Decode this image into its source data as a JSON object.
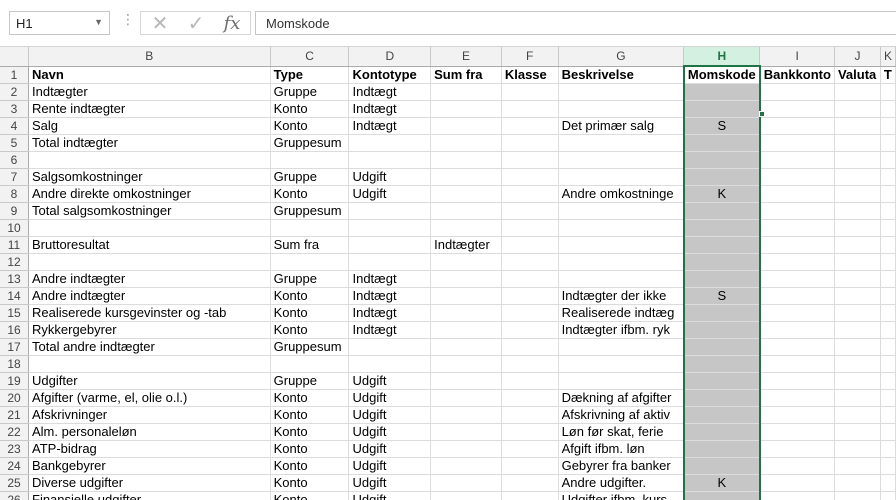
{
  "formula_bar": {
    "name_box": "H1",
    "cancel_icon": "✕",
    "enter_icon": "✓",
    "function_icon": "fx",
    "content": "Momskode"
  },
  "columns": [
    "B",
    "C",
    "D",
    "E",
    "F",
    "G",
    "H",
    "I",
    "J",
    "K"
  ],
  "rows": [
    {
      "n": "1",
      "c": [
        "Navn",
        "Type",
        "Kontotype",
        "Sum fra",
        "Klasse",
        "Beskrivelse",
        "Momskode",
        "Bankkonto",
        "Valuta",
        "T"
      ]
    },
    {
      "n": "2",
      "c": [
        "Indtægter",
        "Gruppe",
        "Indtægt",
        "",
        "",
        "",
        "",
        "",
        "",
        ""
      ]
    },
    {
      "n": "3",
      "c": [
        "Rente indtægter",
        "Konto",
        "Indtægt",
        "",
        "",
        "",
        "",
        "",
        "",
        ""
      ]
    },
    {
      "n": "4",
      "c": [
        "Salg",
        "Konto",
        "Indtægt",
        "",
        "",
        "Det primær salg",
        "S",
        "",
        "",
        ""
      ]
    },
    {
      "n": "5",
      "c": [
        "Total indtægter",
        "Gruppesum",
        "",
        "",
        "",
        "",
        "",
        "",
        "",
        ""
      ]
    },
    {
      "n": "6",
      "c": [
        "",
        "",
        "",
        "",
        "",
        "",
        "",
        "",
        "",
        ""
      ]
    },
    {
      "n": "7",
      "c": [
        "Salgsomkostninger",
        "Gruppe",
        "Udgift",
        "",
        "",
        "",
        "",
        "",
        "",
        ""
      ]
    },
    {
      "n": "8",
      "c": [
        "Andre direkte omkostninger",
        "Konto",
        "Udgift",
        "",
        "",
        "Andre omkostninge",
        "K",
        "",
        "",
        ""
      ]
    },
    {
      "n": "9",
      "c": [
        "Total salgsomkostninger",
        "Gruppesum",
        "",
        "",
        "",
        "",
        "",
        "",
        "",
        ""
      ]
    },
    {
      "n": "10",
      "c": [
        "",
        "",
        "",
        "",
        "",
        "",
        "",
        "",
        "",
        ""
      ]
    },
    {
      "n": "11",
      "c": [
        "Bruttoresultat",
        "Sum fra",
        "",
        "Indtægter",
        "",
        "",
        "",
        "",
        "",
        ""
      ]
    },
    {
      "n": "12",
      "c": [
        "",
        "",
        "",
        "",
        "",
        "",
        "",
        "",
        "",
        ""
      ]
    },
    {
      "n": "13",
      "c": [
        "Andre indtægter",
        "Gruppe",
        "Indtægt",
        "",
        "",
        "",
        "",
        "",
        "",
        ""
      ]
    },
    {
      "n": "14",
      "c": [
        "Andre indtægter",
        "Konto",
        "Indtægt",
        "",
        "",
        "Indtægter der ikke",
        "S",
        "",
        "",
        ""
      ]
    },
    {
      "n": "15",
      "c": [
        "Realiserede kursgevinster og -tab",
        "Konto",
        "Indtægt",
        "",
        "",
        "Realiserede indtæg",
        "",
        "",
        "",
        ""
      ]
    },
    {
      "n": "16",
      "c": [
        "Rykkergebyrer",
        "Konto",
        "Indtægt",
        "",
        "",
        "Indtægter ifbm. ryk",
        "",
        "",
        "",
        ""
      ]
    },
    {
      "n": "17",
      "c": [
        "Total andre indtægter",
        "Gruppesum",
        "",
        "",
        "",
        "",
        "",
        "",
        "",
        ""
      ]
    },
    {
      "n": "18",
      "c": [
        "",
        "",
        "",
        "",
        "",
        "",
        "",
        "",
        "",
        ""
      ]
    },
    {
      "n": "19",
      "c": [
        "Udgifter",
        "Gruppe",
        "Udgift",
        "",
        "",
        "",
        "",
        "",
        "",
        ""
      ]
    },
    {
      "n": "20",
      "c": [
        "Afgifter (varme, el, olie o.l.)",
        "Konto",
        "Udgift",
        "",
        "",
        "Dækning af afgifter",
        "",
        "",
        "",
        ""
      ]
    },
    {
      "n": "21",
      "c": [
        "Afskrivninger",
        "Konto",
        "Udgift",
        "",
        "",
        "Afskrivning af aktiv",
        "",
        "",
        "",
        ""
      ]
    },
    {
      "n": "22",
      "c": [
        "Alm. personaleløn",
        "Konto",
        "Udgift",
        "",
        "",
        "Løn før skat, ferie",
        "",
        "",
        "",
        ""
      ]
    },
    {
      "n": "23",
      "c": [
        "ATP-bidrag",
        "Konto",
        "Udgift",
        "",
        "",
        "Afgift ifbm. løn",
        "",
        "",
        "",
        ""
      ]
    },
    {
      "n": "24",
      "c": [
        "Bankgebyrer",
        "Konto",
        "Udgift",
        "",
        "",
        "Gebyrer fra banker",
        "",
        "",
        "",
        ""
      ]
    },
    {
      "n": "25",
      "c": [
        "Diverse udgifter",
        "Konto",
        "Udgift",
        "",
        "",
        "Andre udgifter.",
        "K",
        "",
        "",
        ""
      ]
    },
    {
      "n": "26",
      "c": [
        "Finansielle udgifter",
        "Konto",
        "Udgift",
        "",
        "",
        "Udgifter ifbm. kurs",
        "",
        "",
        "",
        ""
      ]
    }
  ]
}
